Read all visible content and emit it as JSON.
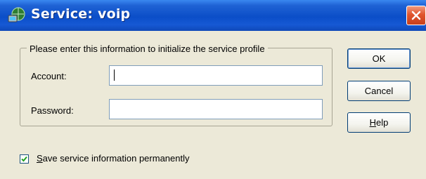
{
  "window": {
    "title": "Service: voip",
    "close_icon": "close-icon",
    "app_icon": "network-service-icon"
  },
  "group": {
    "legend": "Please enter this information to initialize the service profile",
    "account_label": "Account:",
    "account_value": "",
    "password_label": "Password:",
    "password_value": ""
  },
  "buttons": {
    "ok": "OK",
    "cancel": "Cancel",
    "help_h": "H",
    "help_rest": "elp"
  },
  "save_option": {
    "checked": true,
    "label_first": "S",
    "label_rest": "ave service information permanently"
  },
  "colors": {
    "titlebar": "#0b4ec8",
    "face": "#ece9d8",
    "close": "#e0552e"
  }
}
